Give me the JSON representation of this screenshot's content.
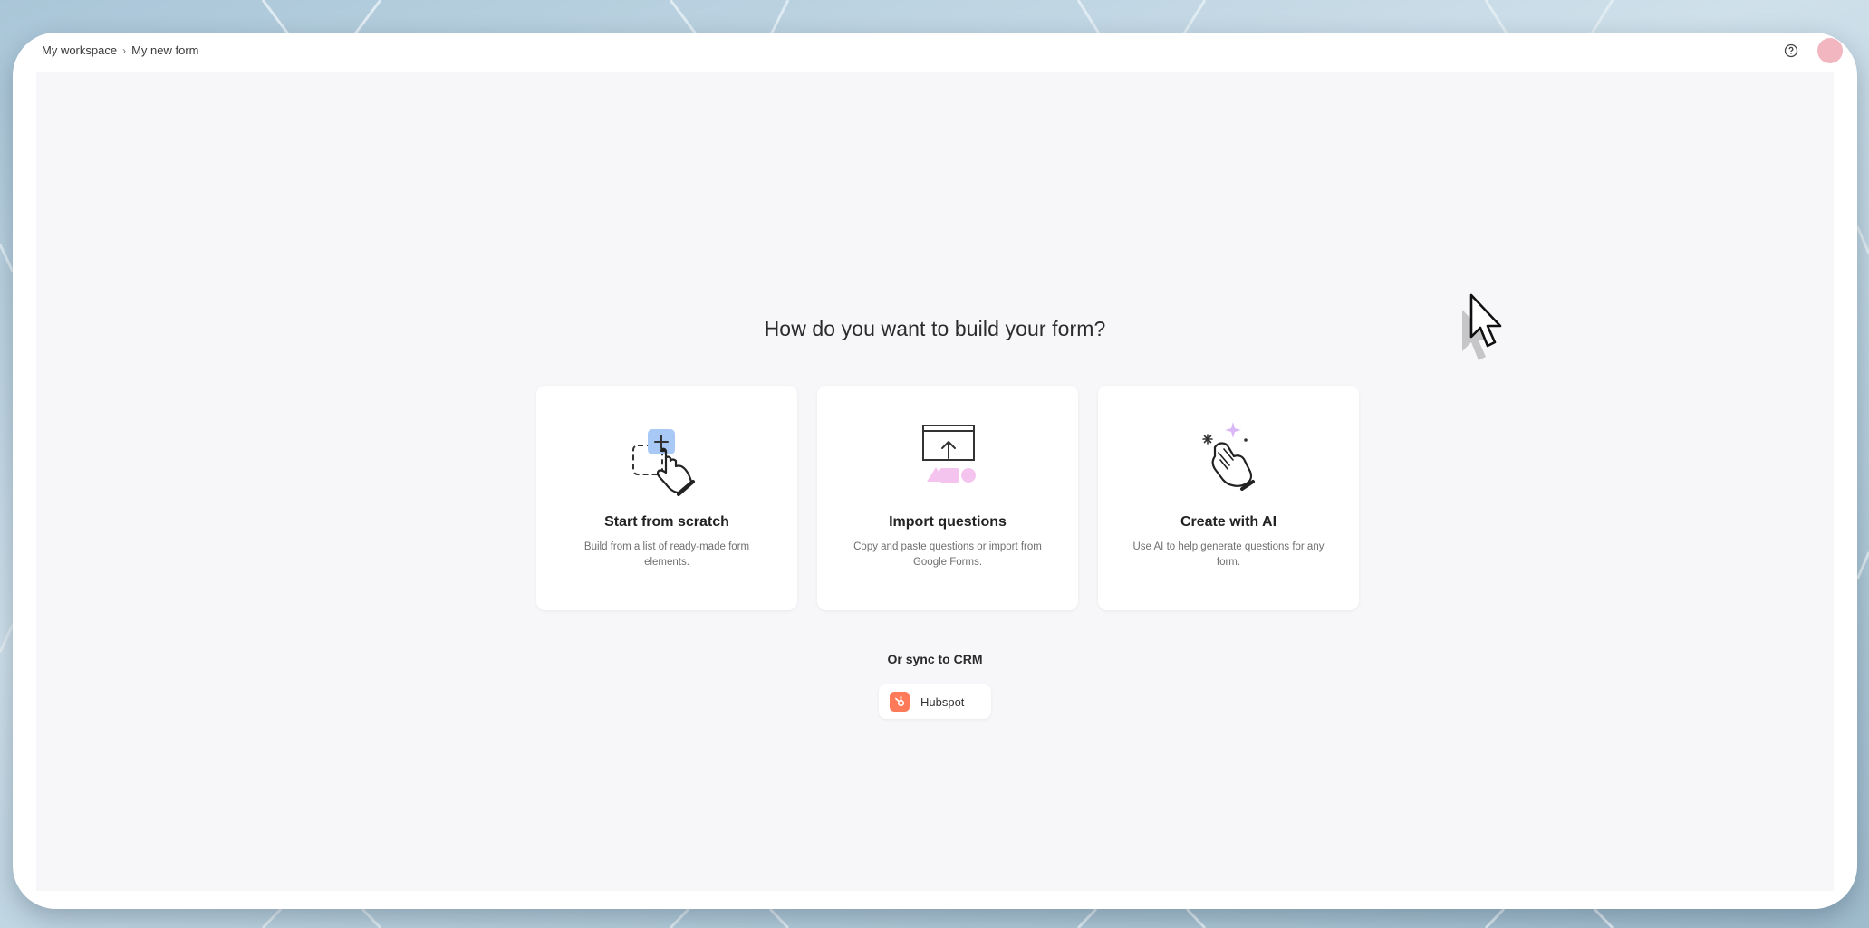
{
  "breadcrumb": {
    "workspace": "My workspace",
    "separator": "›",
    "form": "My new form"
  },
  "topbar": {
    "help_icon": "help-circle-icon",
    "avatar_color": "#f2b6c0"
  },
  "main": {
    "heading": "How do you want to build your form?",
    "cards": [
      {
        "title": "Start from scratch",
        "description": "Build from a list of ready-made form elements.",
        "icon": "hand-add-block-icon"
      },
      {
        "title": "Import questions",
        "description": "Copy and paste questions or import from Google Forms.",
        "icon": "upload-shapes-icon"
      },
      {
        "title": "Create with AI",
        "description": "Use AI to help generate questions for any form.",
        "icon": "sparkle-hand-icon"
      }
    ],
    "sync_label": "Or sync to CRM",
    "hubspot": {
      "label": "Hubspot",
      "icon": "hubspot-icon",
      "color": "#ff7a59"
    }
  },
  "colors": {
    "accent_blue": "#a8c8f5",
    "accent_pink": "#f4c4ef",
    "sparkle_purple": "#d9b8f5",
    "canvas": "#f7f6f9"
  }
}
